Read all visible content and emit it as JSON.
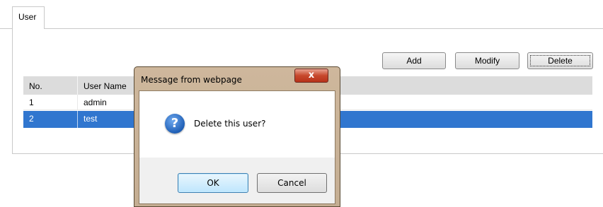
{
  "tabs": [
    {
      "label": "User"
    }
  ],
  "toolbar": {
    "add": "Add",
    "modify": "Modify",
    "delete": "Delete"
  },
  "table": {
    "headers": [
      "No.",
      "User Name"
    ],
    "rows": [
      {
        "no": "1",
        "name": "admin",
        "selected": false
      },
      {
        "no": "2",
        "name": "test",
        "selected": true
      }
    ]
  },
  "dialog": {
    "title": "Message from webpage",
    "close_glyph": "x",
    "message": "Delete this user?",
    "icon": "question-icon",
    "ok": "OK",
    "cancel": "Cancel"
  },
  "colors": {
    "selection": "#3076cf",
    "header": "#dcdcdc"
  }
}
